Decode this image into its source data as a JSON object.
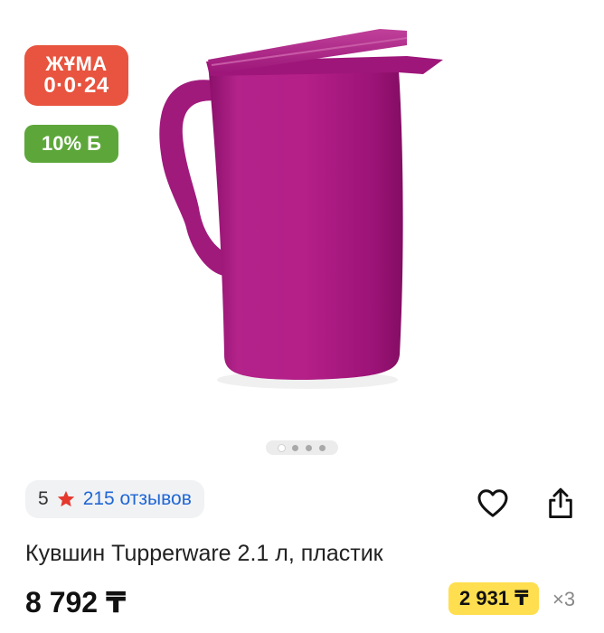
{
  "promo_badge": {
    "line1": "ЖҰМА",
    "line2": "0·0·24",
    "color": "#e8543f"
  },
  "bonus_badge": {
    "text": "10% Б",
    "color": "#5da73a"
  },
  "gallery": {
    "total_images": 4,
    "active_index": 0
  },
  "rating": {
    "value": "5",
    "reviews": "215 отзывов",
    "star_color": "#e5392e"
  },
  "actions": {
    "favorite_icon": "heart-icon",
    "share_icon": "share-icon"
  },
  "product": {
    "title": "Кувшин Tupperware 2.1 л, пластик",
    "price": "8 792 ₸",
    "installment_price": "2 931 ₸",
    "installment_times": "×3",
    "color": "#a8157e"
  }
}
